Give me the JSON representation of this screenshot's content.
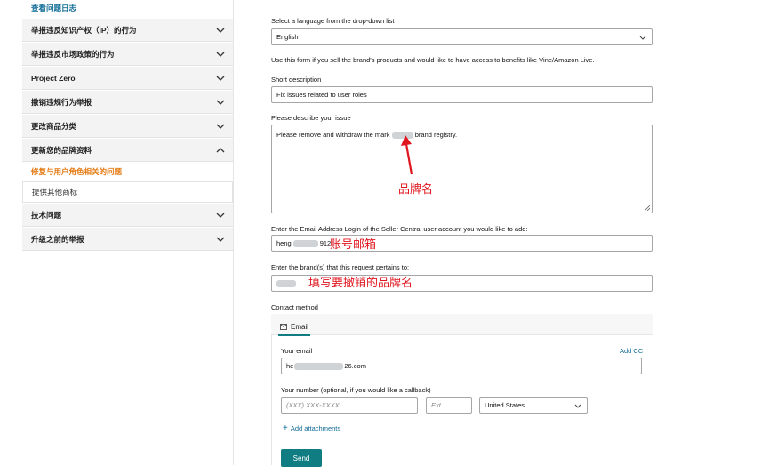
{
  "sidebar": {
    "top_link": "查看问题日志",
    "items": [
      {
        "label": "举报违反知识产权（IP）的行为",
        "state": "collapsed"
      },
      {
        "label": "举报违反市场政策的行为",
        "state": "collapsed"
      },
      {
        "label": "Project Zero",
        "state": "collapsed"
      },
      {
        "label": "撤销违规行为举报",
        "state": "collapsed"
      },
      {
        "label": "更改商品分类",
        "state": "collapsed"
      },
      {
        "label": "更新您的品牌资料",
        "state": "expanded"
      },
      {
        "label": "技术问题",
        "state": "collapsed"
      },
      {
        "label": "升级之前的举报",
        "state": "collapsed"
      }
    ],
    "active_sub": "修复与用户角色相关的问题",
    "sub": "提供其他商标"
  },
  "form": {
    "language_label": "Select a language from the drop-down list",
    "language_value": "English",
    "info_text": "Use this form if you sell the brand's products and would like to have access to benefits like Vine/Amazon Live.",
    "short_desc_label": "Short description",
    "short_desc_value": "Fix issues related to user roles",
    "describe_label": "Please describe your issue",
    "describe_value_a": "Please remove and withdraw the mark",
    "describe_value_b": "brand registry.",
    "email_login_label": "Enter the Email Address Login of the Seller Central user account you would like to add:",
    "email_login_value_a": "heng",
    "email_login_value_b": "912",
    "brand_label": "Enter the brand(s) that this request pertains to:",
    "contact_label": "Contact method",
    "tab_email": "Email",
    "your_email_label": "Your email",
    "add_cc": "Add CC",
    "your_email_value_a": "he",
    "your_email_value_b": "26.com",
    "number_label": "Your number (optional, if you would like a callback)",
    "phone_placeholder": "(XXX) XXX-XXXX",
    "ext_placeholder": "Ext.",
    "country_value": "United States",
    "add_attachments": "Add attachments",
    "send": "Send"
  },
  "annotations": {
    "brand_name": "品牌名",
    "account_email": "账号邮箱",
    "brand_to_revoke": "填写要撤销的品牌名"
  },
  "colors": {
    "accent": "#0f7d82",
    "link": "#0f6b96",
    "active": "#e47911",
    "annotation": "#e0161f"
  }
}
